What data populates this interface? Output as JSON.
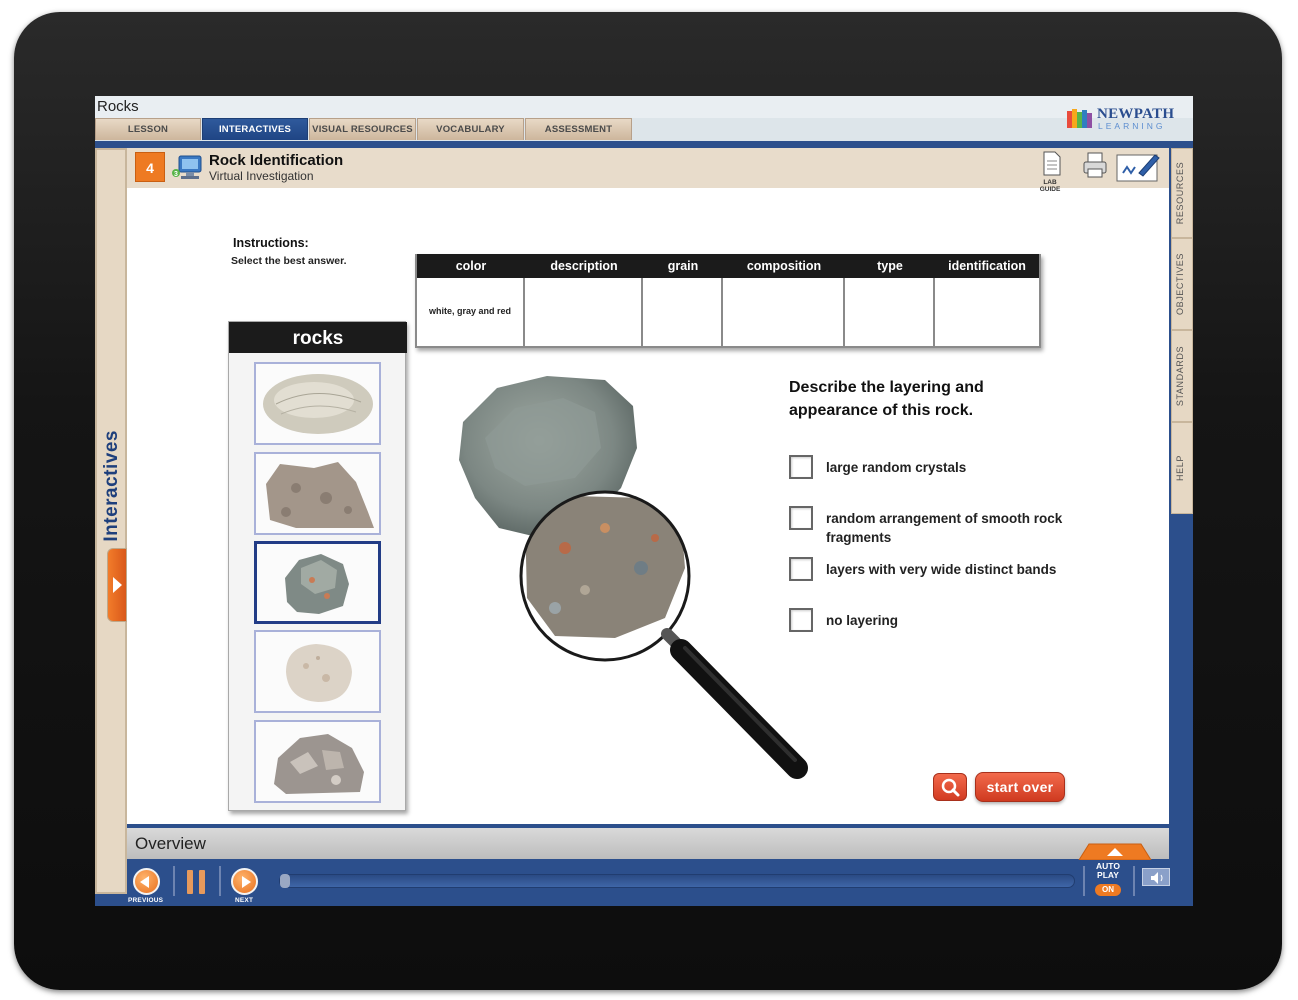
{
  "app": {
    "title": "Rocks"
  },
  "tabs": [
    {
      "label": "LESSON",
      "active": false
    },
    {
      "label": "INTERACTIVES",
      "active": true
    },
    {
      "label": "VISUAL RESOURCES",
      "active": false
    },
    {
      "label": "VOCABULARY",
      "active": false
    },
    {
      "label": "ASSESSMENT",
      "active": false
    }
  ],
  "logo": {
    "line1": "NEWPATH",
    "line2": "LEARNING"
  },
  "left_rail": {
    "label": "Interactives"
  },
  "right_rail": [
    "RESOURCES",
    "OBJECTIVES",
    "STANDARDS",
    "HELP"
  ],
  "lesson": {
    "number": "4",
    "title": "Rock Identification",
    "subtitle": "Virtual Investigation",
    "lab_guide_label": "LAB GUIDE"
  },
  "instructions": {
    "title": "Instructions:",
    "text": "Select the best answer."
  },
  "table": {
    "headers": [
      "color",
      "description",
      "grain",
      "composition",
      "type",
      "identification"
    ],
    "row": [
      "white, gray and red",
      "",
      "",
      "",
      "",
      ""
    ]
  },
  "rocks_panel": {
    "title": "rocks",
    "selected_index": 2,
    "count": 5
  },
  "question": {
    "prompt": "Describe the layering and appearance of this rock.",
    "options": [
      "large random crystals",
      "random arrangement of smooth rock fragments",
      "layers with very wide distinct bands",
      "no layering"
    ]
  },
  "buttons": {
    "start_over": "start over"
  },
  "overview": {
    "label": "Overview"
  },
  "controls": {
    "previous": "PREVIOUS",
    "next": "NEXT",
    "autoplay_line1": "AUTO",
    "autoplay_line2": "PLAY",
    "autoplay_state": "ON"
  },
  "colors": {
    "frame_blue": "#2c4f8c",
    "accent_orange": "#ee7a22",
    "tab_active": "#1f4584",
    "button_red": "#d23b22"
  },
  "icons": [
    "lab-guide-icon",
    "printer-icon",
    "notepad-icon",
    "magnifier-icon",
    "previous-icon",
    "pause-icon",
    "next-icon",
    "volume-icon"
  ]
}
